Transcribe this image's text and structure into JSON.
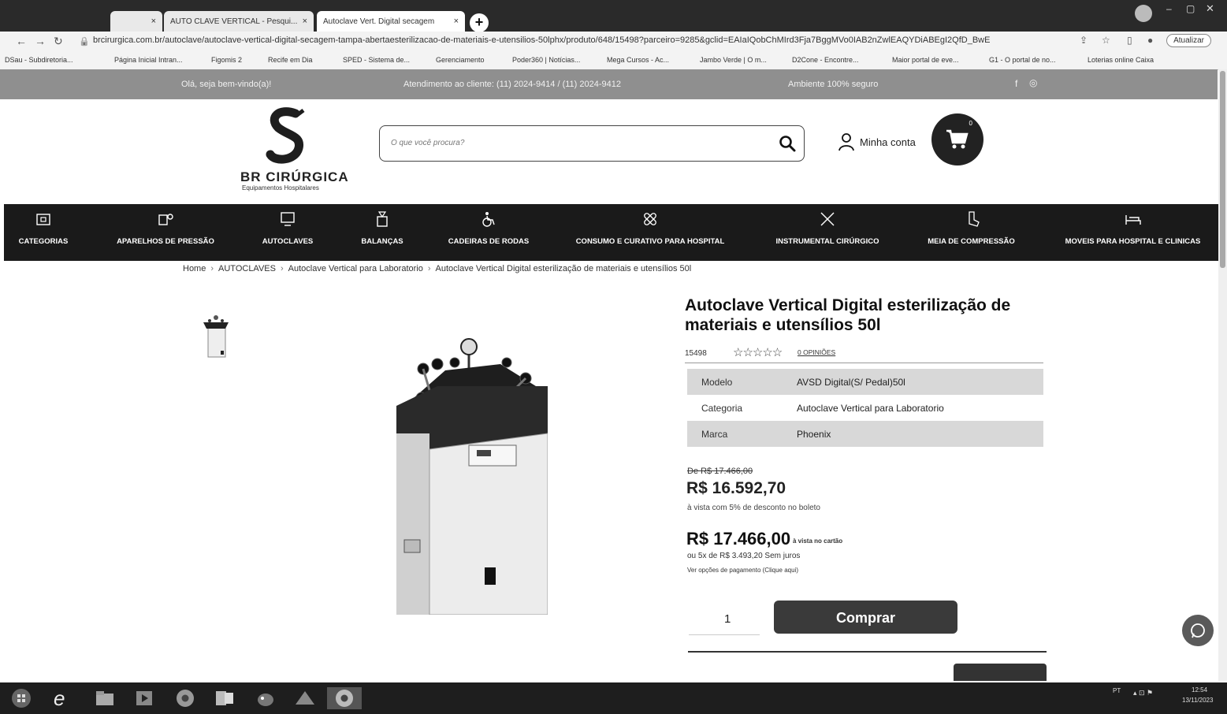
{
  "browser": {
    "tabs": [
      {
        "label": "",
        "close": "×"
      },
      {
        "label": "AUTO CLAVE VERTICAL - Pesqui...",
        "close": "×"
      },
      {
        "label": "Autoclave Vert. Digital secagem",
        "close": "×"
      }
    ],
    "new_tab": "+",
    "url": "brcirurgica.com.br/autoclave/autoclave-vertical-digital-secagem-tampa-abertaesterilizacao-de-materiais-e-utensilios-50lphx/produto/648/15498?parceiro=9285&gclid=EAIaIQobChMIrd3Fja7BggMVo0IAB2nZwlEAQYDiABEgI2QfD_BwE",
    "update_label": "Atualizar",
    "bookmarks": [
      "DSau - Subdiretoria...",
      "Página Inicial Intran...",
      "Figomis 2",
      "Recife em Dia",
      "SPED - Sistema de...",
      "Gerenciamento",
      "Poder360 | Notícias...",
      "Mega Cursos - Ac...",
      "Jambo Verde | O m...",
      "D2Cone - Encontre...",
      "Maior portal de eve...",
      "G1 - O portal de no...",
      "Loterias online Caixa"
    ]
  },
  "promo": {
    "welcome": "Olá, seja bem-vindo(a)!",
    "service": "Atendimento ao cliente: (11) 2024-9414 / (11) 2024-9412",
    "safe": "Ambiente 100% seguro"
  },
  "header": {
    "logo_name": "BR CIRÚRGICA",
    "logo_sub": "Equipamentos Hospitalares",
    "search_placeholder": "O que você procura?",
    "account_label": "Minha conta",
    "cart_count": "0"
  },
  "categories": [
    {
      "label": "CATEGORIAS",
      "icon": "box-icon"
    },
    {
      "label": "APARELHOS DE PRESSÃO",
      "icon": "pressure-icon"
    },
    {
      "label": "AUTOCLAVES",
      "icon": "monitor-icon"
    },
    {
      "label": "BALANÇAS",
      "icon": "scale-icon"
    },
    {
      "label": "CADEIRAS DE RODAS",
      "icon": "wheelchair-icon"
    },
    {
      "label": "CONSUMO E CURATIVO PARA HOSPITAL",
      "icon": "bandage-icon"
    },
    {
      "label": "INSTRUMENTAL CIRÚRGICO",
      "icon": "scissors-icon"
    },
    {
      "label": "MEIA DE COMPRESSÃO",
      "icon": "sock-icon"
    },
    {
      "label": "MOVEIS PARA HOSPITAL E CLINICAS",
      "icon": "bed-icon"
    }
  ],
  "breadcrumb": {
    "items": [
      "Home",
      "AUTOCLAVES",
      "Autoclave Vertical para Laboratorio",
      "Autoclave Vertical Digital esterilização de materiais e utensílios 50l"
    ],
    "separator": "›"
  },
  "product": {
    "title": "Autoclave Vertical Digital esterilização de materiais e utensílios 50l",
    "sku": "15498",
    "rating": 0,
    "stars": "☆☆☆☆☆",
    "reviews_label": "0 OPINIÕES",
    "specs": [
      {
        "key": "Modelo",
        "value": "AVSD Digital(S/ Pedal)50l"
      },
      {
        "key": "Categoria",
        "value": "Autoclave Vertical para Laboratorio"
      },
      {
        "key": "Marca",
        "value": "Phoenix"
      }
    ],
    "old_price": "De R$ 17.466,00",
    "pix_price": "R$ 16.592,70",
    "pix_note": "à vista com 5% de desconto no boleto",
    "card_price": "R$ 17.466,00",
    "card_note": "à vista no cartão",
    "installments": "ou 5x de R$ 3.493,20 Sem juros",
    "payment_options": "Ver opções de pagamento (Clique aqui)",
    "quantity": "1",
    "buy_label": "Comprar"
  },
  "taskbar": {
    "lang": "PT",
    "time": "12:54",
    "date": "13/11/2023"
  }
}
